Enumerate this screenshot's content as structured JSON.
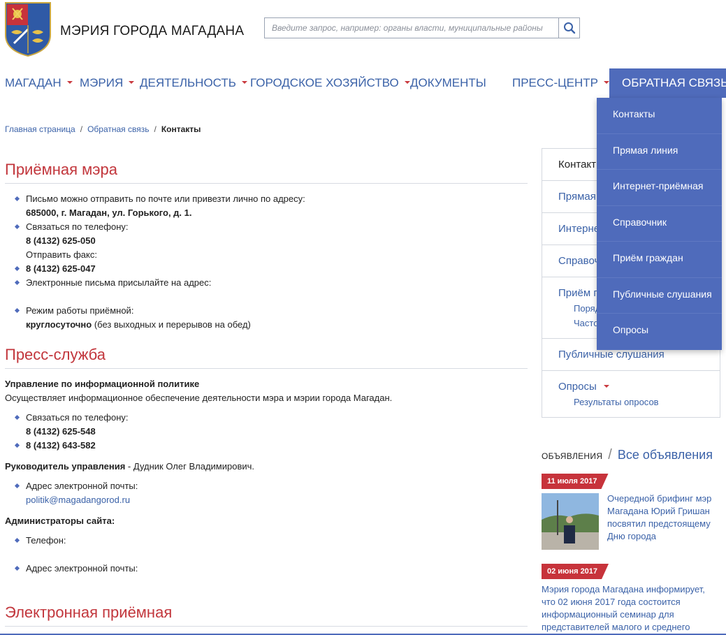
{
  "header": {
    "logo": "magadan-coat-of-arms",
    "title": "МЭРИЯ ГОРОДА МАГАДАНА",
    "search_placeholder": "Введите запрос, например: органы власти, муниципальные районы",
    "search_icon": "search-icon"
  },
  "nav": [
    {
      "label": "МАГАДАН",
      "caret": true
    },
    {
      "label": "МЭРИЯ",
      "caret": true
    },
    {
      "label": "ДЕЯТЕЛЬНОСТЬ",
      "caret": true
    },
    {
      "label": "ГОРОДСКОЕ ХОЗЯЙСТВО",
      "caret": true
    },
    {
      "label": "ДОКУМЕНТЫ",
      "caret": false
    },
    {
      "label": "ПРЕСС-ЦЕНТР",
      "caret": true
    },
    {
      "label": "ОБРАТНАЯ СВЯЗЬ",
      "caret": true,
      "active": true
    }
  ],
  "dropdown": [
    "Контакты",
    "Прямая линия",
    "Интернет-приёмная",
    "Справочник",
    "Приём граждан",
    "Публичные слушания",
    "Опросы"
  ],
  "breadcrumb": {
    "home": "Главная страница",
    "parent": "Обратная связь",
    "current": "Контакты",
    "separator": "/"
  },
  "reception": {
    "heading": "Приёмная мэра",
    "mail_text": "Письмо можно отправить по почте или привезти лично по адресу:",
    "address": "685000, г. Магадан, ул. Горького, д. 1.",
    "phone_text": "Связаться по телефону:",
    "phone": "8 (4132) 625-050",
    "fax_text": "Отправить факс:",
    "fax": "8 (4132) 625-047",
    "email_text": "Электронные письма присылайте на адрес:",
    "hours_text": "Режим работы приёмной:",
    "hours_bold": "круглосуточно",
    "hours_note": " (без выходных и перерывов на обед)"
  },
  "press": {
    "heading": "Пресс-служба",
    "dept": "Управление по информационной политике",
    "desc": "Осуществляет информационное обеспечение деятельности мэра и мэрии города Магадан.",
    "phone_text": "Связаться по телефону:",
    "phone1": "8 (4132) 625-548",
    "phone2": "8 (4132) 643-582",
    "head_label": "Руководитель управления",
    "head_name": " - Дудник Олег Владимирович.",
    "email_text": "Адрес электронной почты:",
    "email": "politik@magadangorod.ru",
    "admins_label": "Администраторы сайта:",
    "admin_phone": "Телефон:",
    "admin_email": "Адрес электронной почты:"
  },
  "e_reception": {
    "heading": "Электронная приёмная"
  },
  "sidemenu": {
    "contacts": "Контакты",
    "hotline": "Прямая линия",
    "internet": "Интернет-приёмная",
    "directory": "Справочник",
    "reception": "Приём граждан",
    "reception_sub1": "Порядок",
    "reception_sub2": "Часто задаваемые вопросы",
    "hearings": "Публичные слушания",
    "polls": "Опросы",
    "polls_sub": "Результаты опросов"
  },
  "announcements": {
    "label": "ОБЪЯВЛЕНИЯ",
    "separator": "/",
    "all": "Все объявления",
    "items": [
      {
        "date": "11 июля 2017",
        "text": "Очередной брифинг мэр Магадана Юрий Гришан посвятил предстоящему Дню города"
      },
      {
        "date": "02 июня 2017",
        "text": "Мэрия города Магадана информирует, что 02 июня 2017 года состоится информационный семинар для представителей малого и среднего"
      }
    ]
  },
  "colors": {
    "brand_blue": "#4f6bbb",
    "link_blue": "#3b62a8",
    "heading_red": "#c2363c"
  }
}
